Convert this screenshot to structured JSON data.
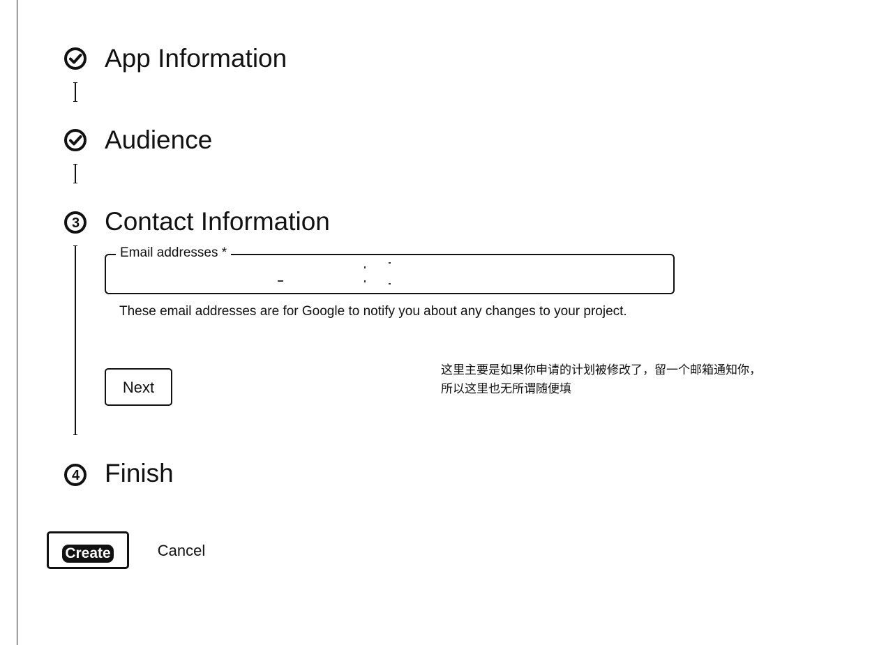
{
  "steps": [
    {
      "number": "",
      "title": "App Information",
      "state": "completed",
      "icon": "check-circle-icon"
    },
    {
      "number": "",
      "title": "Audience",
      "state": "completed",
      "icon": "check-circle-icon"
    },
    {
      "number": "3",
      "title": "Contact Information",
      "state": "active",
      "icon": "step-number-icon"
    },
    {
      "number": "4",
      "title": "Finish",
      "state": "pending",
      "icon": "step-number-icon"
    }
  ],
  "contact": {
    "email_label": "Email addresses *",
    "email_value": "",
    "helper_text": "These email addresses are for Google to notify you about any changes to your project.",
    "next_label": "Next"
  },
  "annotation": {
    "line1": "这里主要是如果你申请的计划被修改了，留一个邮箱通知你，",
    "line2": "所以这里也无所谓随便填"
  },
  "actions": {
    "create_label": "Create",
    "cancel_label": "Cancel"
  },
  "colors": {
    "ink": "#111111",
    "background": "#ffffff"
  }
}
